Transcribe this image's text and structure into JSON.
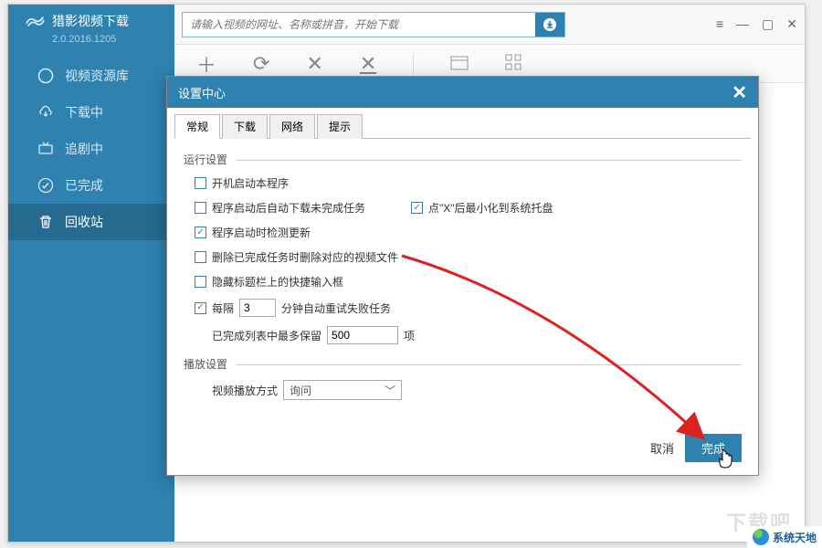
{
  "app": {
    "title": "猎影视频下载",
    "version": "2.0.2016.1205"
  },
  "search": {
    "placeholder": "请输入视频的网址、名称或拼音，开始下载"
  },
  "sidebar": {
    "items": [
      {
        "label": "视频资源库"
      },
      {
        "label": "下载中"
      },
      {
        "label": "追剧中"
      },
      {
        "label": "已完成"
      },
      {
        "label": "回收站"
      }
    ]
  },
  "modal": {
    "title": "设置中心",
    "tabs": [
      "常规",
      "下载",
      "网络",
      "提示"
    ],
    "group_run": "运行设置",
    "group_play": "播放设置",
    "opt_autostart": "开机启动本程序",
    "opt_resume": "程序启动后自动下载未完成任务",
    "opt_minimize": "点\"X\"后最小化到系统托盘",
    "opt_update": "程序启动时检测更新",
    "opt_delvideo": "删除已完成任务时删除对应的视频文件",
    "opt_hidetitle": "隐藏标题栏上的快捷输入框",
    "opt_retry_pre": "每隔",
    "opt_retry_val": "3",
    "opt_retry_post": "分钟自动重试失败任务",
    "opt_keep_pre": "已完成列表中最多保留",
    "opt_keep_val": "500",
    "opt_keep_post": "项",
    "playmode_label": "视频播放方式",
    "playmode_value": "询问",
    "cancel": "取消",
    "ok": "完成"
  },
  "badge": {
    "text": "系统天地"
  },
  "watermark": "下载吧"
}
